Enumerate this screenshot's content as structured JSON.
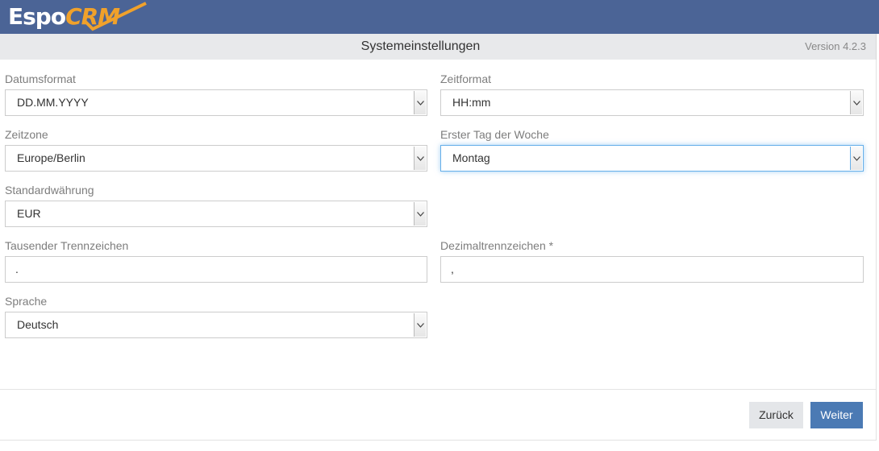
{
  "header": {
    "logo_text_espo": "Espo",
    "logo_text_crm": "CRM",
    "title": "Systemeinstellungen",
    "version": "Version 4.2.3"
  },
  "colors": {
    "topbar": "#4b6496",
    "accent": "#f0a12b",
    "primary_button": "#4b7ab4"
  },
  "fields": {
    "date_format": {
      "label": "Datumsformat",
      "value": "DD.MM.YYYY"
    },
    "time_format": {
      "label": "Zeitformat",
      "value": "HH:mm"
    },
    "timezone": {
      "label": "Zeitzone",
      "value": "Europe/Berlin"
    },
    "week_start": {
      "label": "Erster Tag der Woche",
      "value": "Montag"
    },
    "currency": {
      "label": "Standardwährung",
      "value": "EUR"
    },
    "thousand_separator": {
      "label": "Tausender Trennzeichen",
      "value": "."
    },
    "decimal_mark": {
      "label": "Dezimaltrennzeichen *",
      "value": ","
    },
    "language": {
      "label": "Sprache",
      "value": "Deutsch"
    }
  },
  "buttons": {
    "back": "Zurück",
    "next": "Weiter"
  },
  "icons": {
    "select_arrow": "chevron-down-icon"
  }
}
